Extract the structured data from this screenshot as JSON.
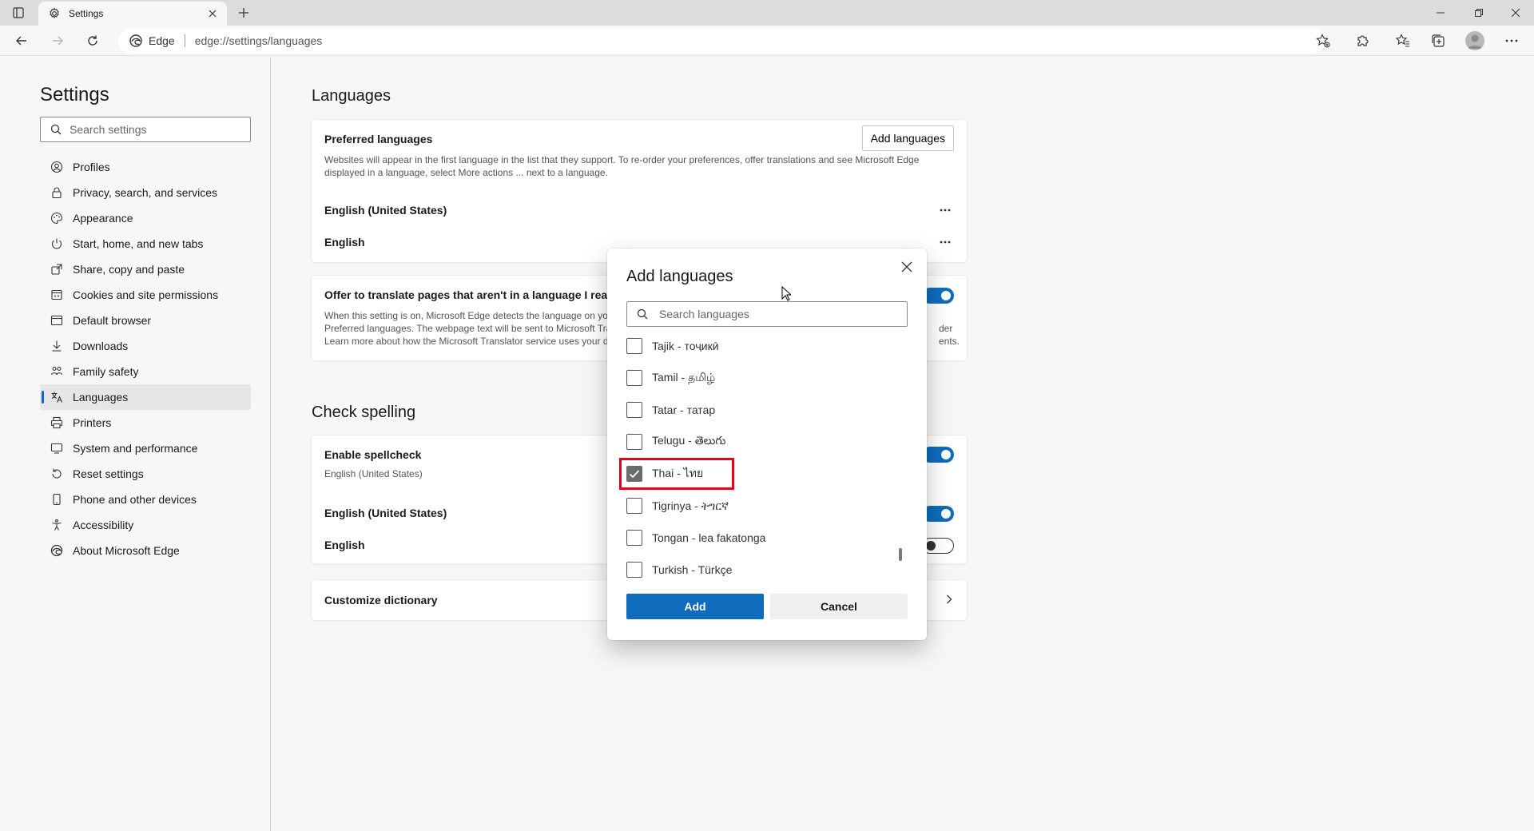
{
  "browser": {
    "tab_title": "Settings",
    "address_brand": "Edge",
    "address_url": "edge://settings/languages"
  },
  "sidebar": {
    "title": "Settings",
    "search_placeholder": "Search settings",
    "items": [
      {
        "label": "Profiles",
        "icon": "profile-icon"
      },
      {
        "label": "Privacy, search, and services",
        "icon": "lock-icon"
      },
      {
        "label": "Appearance",
        "icon": "appearance-icon"
      },
      {
        "label": "Start, home, and new tabs",
        "icon": "power-icon"
      },
      {
        "label": "Share, copy and paste",
        "icon": "share-icon"
      },
      {
        "label": "Cookies and site permissions",
        "icon": "cookies-icon"
      },
      {
        "label": "Default browser",
        "icon": "browser-icon"
      },
      {
        "label": "Downloads",
        "icon": "download-icon"
      },
      {
        "label": "Family safety",
        "icon": "family-icon"
      },
      {
        "label": "Languages",
        "icon": "languages-icon"
      },
      {
        "label": "Printers",
        "icon": "printer-icon"
      },
      {
        "label": "System and performance",
        "icon": "system-icon"
      },
      {
        "label": "Reset settings",
        "icon": "reset-icon"
      },
      {
        "label": "Phone and other devices",
        "icon": "phone-icon"
      },
      {
        "label": "Accessibility",
        "icon": "accessibility-icon"
      },
      {
        "label": "About Microsoft Edge",
        "icon": "edge-icon"
      }
    ],
    "active_index": 9
  },
  "main": {
    "languages_heading": "Languages",
    "preferred": {
      "title": "Preferred languages",
      "add_button": "Add languages",
      "description_line1": "Websites will appear in the first language in the list that they support. To re-order your preferences, offer translations and see Microsoft Edge",
      "description_line2": "displayed in a language, select More actions ... next to a language.",
      "languages": [
        "English (United States)",
        "English"
      ]
    },
    "translate": {
      "title": "Offer to translate pages that aren't in a language I read",
      "desc_line1": "When this setting is on, Microsoft Edge detects the language on yo",
      "desc_line2": "Preferred languages. The webpage text will be sent to Microsoft Tra",
      "desc_line3": "Learn more about how the Microsoft Translator service uses your d",
      "desc_tail1": "der",
      "desc_tail2": "ents.",
      "enabled": true
    },
    "spelling_heading": "Check spelling",
    "spellcheck": {
      "title": "Enable spellcheck",
      "subtitle": "English (United States)",
      "lang1": "English (United States)",
      "lang2": "English"
    },
    "customize": "Customize dictionary"
  },
  "dialog": {
    "title": "Add languages",
    "search_placeholder": "Search languages",
    "items": [
      {
        "label": "Tajik - тоҷикӣ",
        "checked": false
      },
      {
        "label": "Tamil - தமிழ்",
        "checked": false
      },
      {
        "label": "Tatar - татар",
        "checked": false
      },
      {
        "label": "Telugu - తెలుగు",
        "checked": false
      },
      {
        "label": "Thai - ไทย",
        "checked": true
      },
      {
        "label": "Tigrinya - ትግርኛ",
        "checked": false
      },
      {
        "label": "Tongan - lea fakatonga",
        "checked": false
      },
      {
        "label": "Turkish - Türkçe",
        "checked": false
      }
    ],
    "add_button": "Add",
    "cancel_button": "Cancel"
  }
}
